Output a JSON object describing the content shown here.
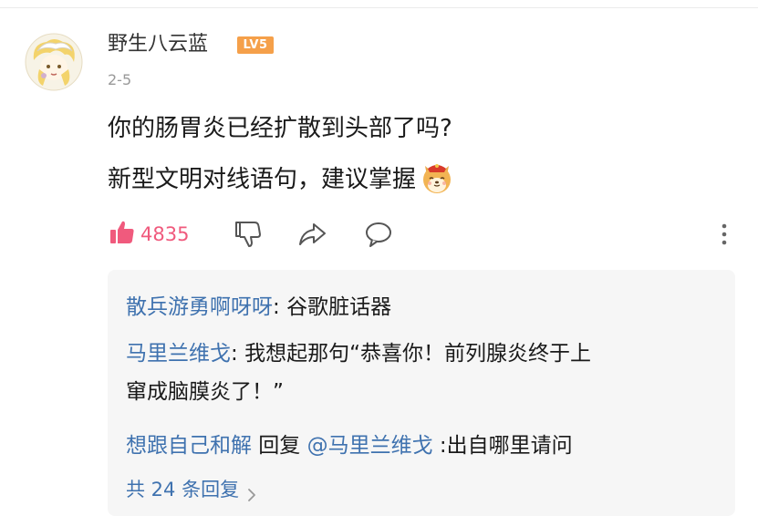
{
  "comment": {
    "username": "野生八云蓝",
    "level_badge": "LV5",
    "date": "2-5",
    "lines": [
      "你的肠胃炎已经扩散到头部了吗?",
      "新型文明对线语句，建议掌握"
    ],
    "emoji": "dog-emoji"
  },
  "actions": {
    "like_count": "4835",
    "like_icon": "thumbs-up-icon",
    "dislike_icon": "thumbs-down-icon",
    "share_icon": "share-icon",
    "reply_icon": "comment-bubble-icon",
    "more_icon": "more-vertical-icon"
  },
  "replies": [
    {
      "user": "散兵游勇啊呀呀",
      "separator": ": ",
      "text": "谷歌脏话器"
    },
    {
      "user": "马里兰维戈",
      "separator": ": ",
      "text_line1": "我想起那句“恭喜你！前列腺炎终于上",
      "text_line2": "窜成脑膜炎了！”"
    },
    {
      "user": "想跟自己和解",
      "reply_word": " 回复 ",
      "reply_to": "@马里兰维戈",
      "text": " :出自哪里请问"
    }
  ],
  "more_replies_label": "共 24 条回复",
  "colors": {
    "accent_blue": "#3f72af",
    "like_pink": "#f05a7d",
    "badge_orange": "#f5a04a",
    "reply_bg": "#f6f6f6",
    "muted": "#999999"
  }
}
